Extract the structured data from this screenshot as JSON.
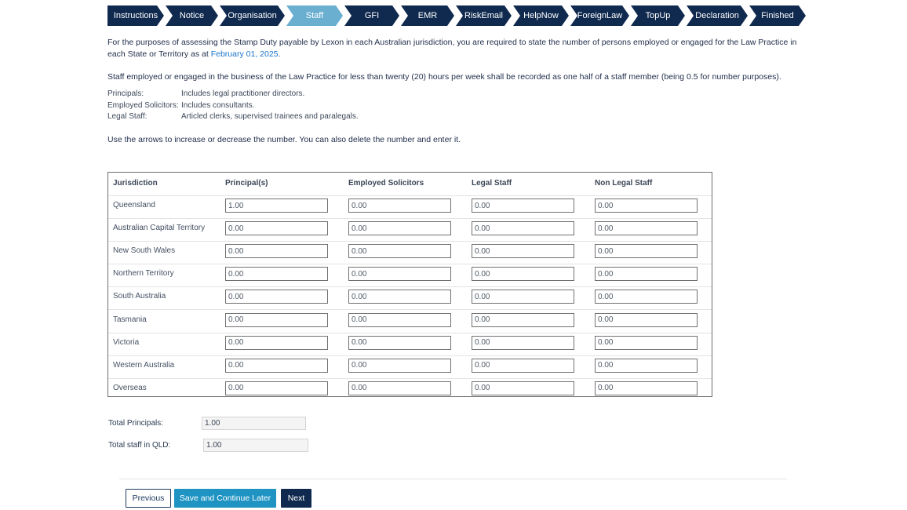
{
  "steps": [
    {
      "label": "Instructions",
      "active": false
    },
    {
      "label": "Notice",
      "active": false
    },
    {
      "label": "Organisation",
      "active": false
    },
    {
      "label": "Staff",
      "active": true
    },
    {
      "label": "GFI",
      "active": false
    },
    {
      "label": "EMR",
      "active": false
    },
    {
      "label": "RiskEmail",
      "active": false
    },
    {
      "label": "HelpNow",
      "active": false
    },
    {
      "label": "ForeignLaw",
      "active": false
    },
    {
      "label": "TopUp",
      "active": false
    },
    {
      "label": "Declaration",
      "active": false
    },
    {
      "label": "Finished",
      "active": false
    }
  ],
  "intro": {
    "text_before": "For the purposes of assessing the Stamp Duty payable by Lexon in each Australian jurisdiction, you are required to state the number of persons employed or engaged for the Law Practice in each State or Territory as at ",
    "date": "February 01, 2025",
    "text_after": "."
  },
  "half_note": "Staff employed or engaged in the business of the Law Practice for less than twenty (20) hours per week shall be recorded as one half of a staff member (being 0.5 for number purposes).",
  "definitions": [
    {
      "term": "Principals:",
      "desc": "Includes legal practitioner directors."
    },
    {
      "term": "Employed Solicitors:",
      "desc": "Includes consultants."
    },
    {
      "term": "Legal Staff:",
      "desc": "Articled clerks, supervised trainees and paralegals."
    }
  ],
  "arrows_note": "Use the arrows to increase or decrease the number. You can also delete the number and enter it.",
  "table": {
    "headers": [
      "Jurisdiction",
      "Principal(s)",
      "Employed Solicitors",
      "Legal Staff",
      "Non Legal Staff"
    ],
    "rows": [
      {
        "jurisdiction": "Queensland",
        "values": [
          "1.00",
          "0.00",
          "0.00",
          "0.00"
        ]
      },
      {
        "jurisdiction": "Australian Capital Territory",
        "values": [
          "0.00",
          "0.00",
          "0.00",
          "0.00"
        ]
      },
      {
        "jurisdiction": "New South Wales",
        "values": [
          "0.00",
          "0.00",
          "0.00",
          "0.00"
        ]
      },
      {
        "jurisdiction": "Northern Territory",
        "values": [
          "0.00",
          "0.00",
          "0.00",
          "0.00"
        ]
      },
      {
        "jurisdiction": "South Australia",
        "values": [
          "0.00",
          "0.00",
          "0.00",
          "0.00"
        ]
      },
      {
        "jurisdiction": "Tasmania",
        "values": [
          "0.00",
          "0.00",
          "0.00",
          "0.00"
        ]
      },
      {
        "jurisdiction": "Victoria",
        "values": [
          "0.00",
          "0.00",
          "0.00",
          "0.00"
        ]
      },
      {
        "jurisdiction": "Western Australia",
        "values": [
          "0.00",
          "0.00",
          "0.00",
          "0.00"
        ]
      },
      {
        "jurisdiction": "Overseas",
        "values": [
          "0.00",
          "0.00",
          "0.00",
          "0.00"
        ]
      }
    ]
  },
  "totals": {
    "principals_label": "Total Principals:",
    "principals_value": "1.00",
    "qld_label": "Total staff in QLD:",
    "qld_value": "1.00"
  },
  "buttons": {
    "previous": "Previous",
    "save": "Save and Continue Later",
    "next": "Next"
  }
}
